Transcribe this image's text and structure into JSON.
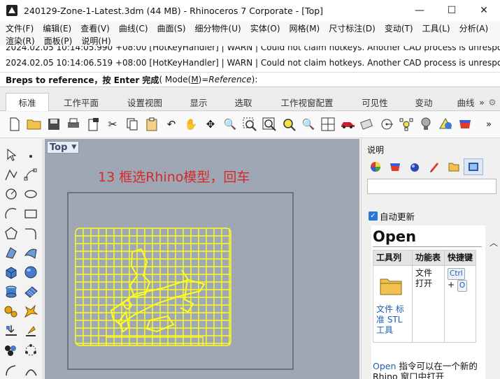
{
  "window": {
    "title": "240129-Zone-1-Latest.3dm (44 MB) - Rhinoceros 7 Corporate - [Top]",
    "minimize": "—",
    "maximize": "☐",
    "close": "✕"
  },
  "menus": {
    "row1": [
      "文件(F)",
      "编辑(E)",
      "查看(V)",
      "曲线(C)",
      "曲面(S)",
      "细分物件(U)",
      "实体(O)",
      "网格(M)",
      "尺寸标注(D)",
      "变动(T)",
      "工具(L)",
      "分析(A)"
    ],
    "row2": [
      "渲染(R)",
      "面板(P)",
      "说明(H)"
    ]
  },
  "history": {
    "line1": "2024.02.05 10:14:05.990 +08:00 [HotKeyHandler] | WARN | Could not claim hotkeys. Another CAD process is unrespon",
    "line2": "2024.02.05 10:14:06.519 +08:00 [HotKeyHandler] | WARN | Could not claim hotkeys. Another CAD process is unrespon"
  },
  "command": {
    "prompt": "Breps to reference，按 Enter 完成",
    "option_open": " ( Mode(",
    "option_key": "M",
    "option_eq": ")=",
    "option_value": "Reference",
    "option_close": " ):"
  },
  "tabs": [
    "标准",
    "工作平面",
    "设置视图",
    "显示",
    "选取",
    "工作视窗配置",
    "可见性",
    "变动",
    "曲线"
  ],
  "tab_more": "»",
  "viewport": {
    "name": "Top",
    "annotation": "13 框选Rhino模型，回车"
  },
  "panel": {
    "title": "说明",
    "auto_update": "自动更新",
    "doc_title": "Open",
    "table_headers": [
      "工具列",
      "功能表",
      "快捷键"
    ],
    "toolbar_names": "文件 标准 STL 工具",
    "menu_path": "文件 打开",
    "shortcut_key1": "Ctrl",
    "shortcut_plus": "+",
    "shortcut_key2": "O",
    "footer_link": "Open",
    "footer_text": " 指令可以在一个新的 Rhino 窗口中打开"
  },
  "colors": {
    "model": "#ffff1a",
    "annotation": "#d42a2a",
    "viewport_bg": "#9ea7b3",
    "link": "#1a5fb4"
  }
}
